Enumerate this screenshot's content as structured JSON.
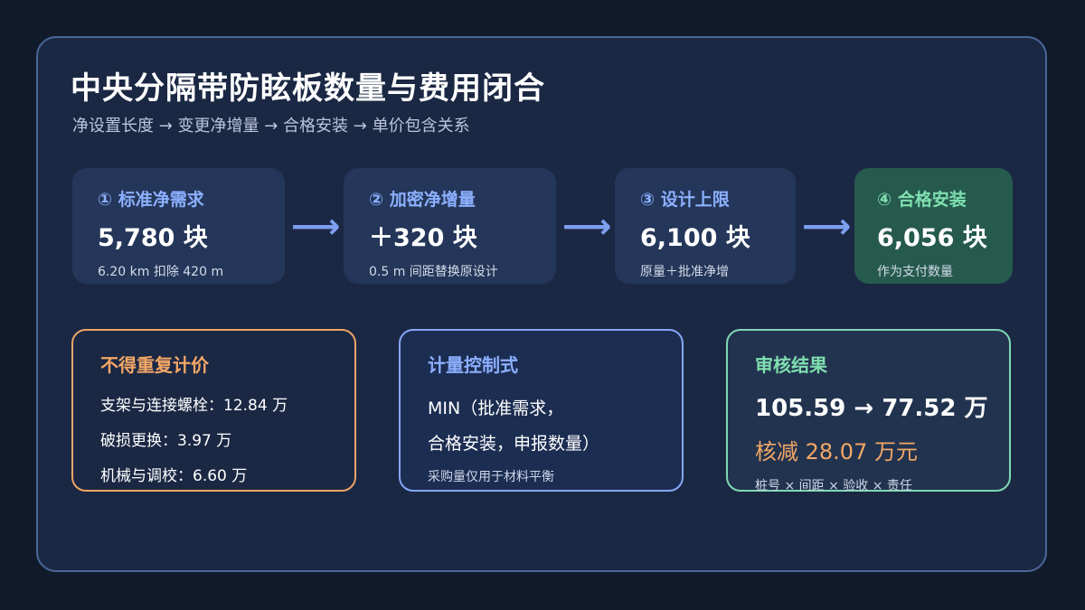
{
  "title": "中央分隔带防眩板数量与费用闭合",
  "subtitle": "净设置长度 → 变更净增量 → 合格安装 → 单价包含关系",
  "steps": [
    {
      "label": "① 标准净需求",
      "value": "5,780 块",
      "note": "6.20 km 扣除 420 m"
    },
    {
      "label": "② 加密净增量",
      "value": "＋320 块",
      "note": "0.5 m 间距替换原设计"
    },
    {
      "label": "③ 设计上限",
      "value": "6,100 块",
      "note": "原量＋批准净增"
    },
    {
      "label": "④ 合格安装",
      "value": "6,056 块",
      "note": "作为支付数量"
    }
  ],
  "arrow_symbol": "⟶",
  "boxes": {
    "no_repeat": {
      "title": "不得重复计价",
      "lines": [
        "支架与连接螺栓：12.84 万",
        "破损更换：3.97 万",
        "机械与调校：6.60 万"
      ]
    },
    "formula": {
      "title": "计量控制式",
      "line1": "MIN（批准需求，",
      "line2": "合格安装，申报数量）",
      "note": "采购量仅用于材料平衡"
    },
    "result": {
      "title": "审核结果",
      "amount": "105.59 → 77.52 万",
      "reduction": "核减 28.07 万元",
      "note": "桩号 × 间距 × 验收 × 责任"
    }
  },
  "colors": {
    "background": "#111a2b",
    "card": "#1b2844",
    "accent_blue": "#8cb0ff",
    "accent_green": "#7fe0b0",
    "accent_orange": "#f3a766"
  }
}
